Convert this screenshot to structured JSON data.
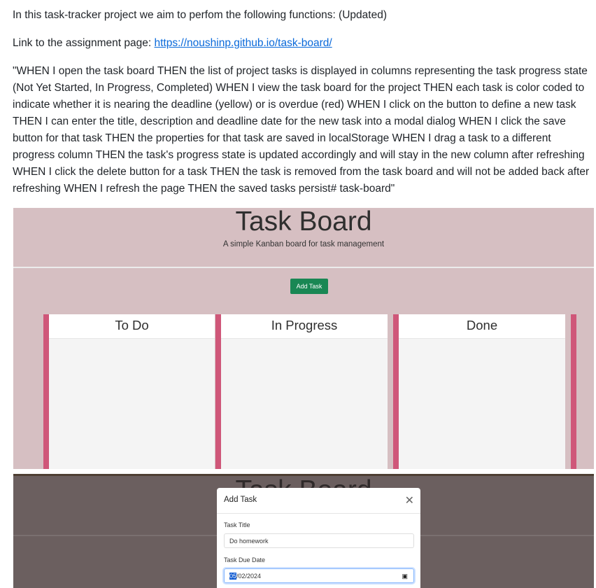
{
  "readme": {
    "intro": "In this task-tracker project we aim to perfom the following functions: (Updated)",
    "link_prefix": "Link to the assignment page: ",
    "link_text": "https://noushinp.github.io/task-board/",
    "story": "\"WHEN I open the task board THEN the list of project tasks is displayed in columns representing the task progress state (Not Yet Started, In Progress, Completed) WHEN I view the task board for the project THEN each task is color coded to indicate whether it is nearing the deadline (yellow) or is overdue (red) WHEN I click on the button to define a new task THEN I can enter the title, description and deadline date for the new task into a modal dialog WHEN I click the save button for that task THEN the properties for that task are saved in localStorage WHEN I drag a task to a different progress column THEN the task's progress state is updated accordingly and will stay in the new column after refreshing WHEN I click the delete button for a task THEN the task is removed from the task board and will not be added back after refreshing WHEN I refresh the page THEN the saved tasks persist# task-board\""
  },
  "board": {
    "title": "Task Board",
    "subtitle": "A simple Kanban board for task management",
    "add_button": "Add Task",
    "lanes": [
      "To Do",
      "In Progress",
      "Done"
    ]
  },
  "modal": {
    "background_title": "Task Board",
    "title": "Add Task",
    "close_icon": "close-icon",
    "title_label": "Task Title",
    "title_value": "Do homework",
    "date_label": "Task Due Date",
    "date_month_selected": "05",
    "date_rest": "/02/2024",
    "calendar_icon": "calendar-icon"
  },
  "colors": {
    "board_bg": "#d6bfc2",
    "lane_accent": "#cf5779",
    "button_green": "#198754",
    "link": "#0969da"
  }
}
